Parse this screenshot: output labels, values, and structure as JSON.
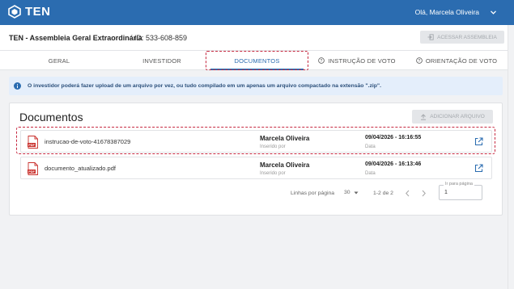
{
  "app": {
    "logo_text": "TEN",
    "user_greeting": "Olá, Marcela Oliveira"
  },
  "header": {
    "title": "TEN - Assembleia Geral Extraordinária",
    "event_id": "ID: 533-608-859",
    "access_button": "ACESSAR ASSEMBLEIA"
  },
  "tabs": [
    {
      "label": "GERAL"
    },
    {
      "label": "INVESTIDOR"
    },
    {
      "label": "DOCUMENTOS"
    },
    {
      "label": "INSTRUÇÃO DE VOTO"
    },
    {
      "label": "ORIENTAÇÃO DE VOTO"
    }
  ],
  "info_message": "O investidor poderá fazer upload de um arquivo por vez, ou tudo compilado em um apenas um arquivo compactado na extensão \".zip\".",
  "documents": {
    "title": "Documentos",
    "add_button": "ADICIONAR ARQUIVO",
    "rows": [
      {
        "file": "instrucao-de-voto-41678387029",
        "user": "Marcela Oliveira",
        "user_label": "Inserido por",
        "date": "09/04/2026 - 16:16:55",
        "date_label": "Data"
      },
      {
        "file": "documento_atualizado.pdf",
        "user": "Marcela Oliveira",
        "user_label": "Inserido por",
        "date": "09/04/2026 - 16:13:46",
        "date_label": "Data"
      }
    ]
  },
  "pagination": {
    "rows_per_page_label": "Linhas por página",
    "rows_per_page_value": "30",
    "range": "1-2 de 2",
    "goto_label": "Ir para página",
    "goto_value": "1"
  },
  "colors": {
    "primary": "#2b6cb0",
    "highlight_dash": "#c62840",
    "info_bg": "#e4eefb"
  }
}
